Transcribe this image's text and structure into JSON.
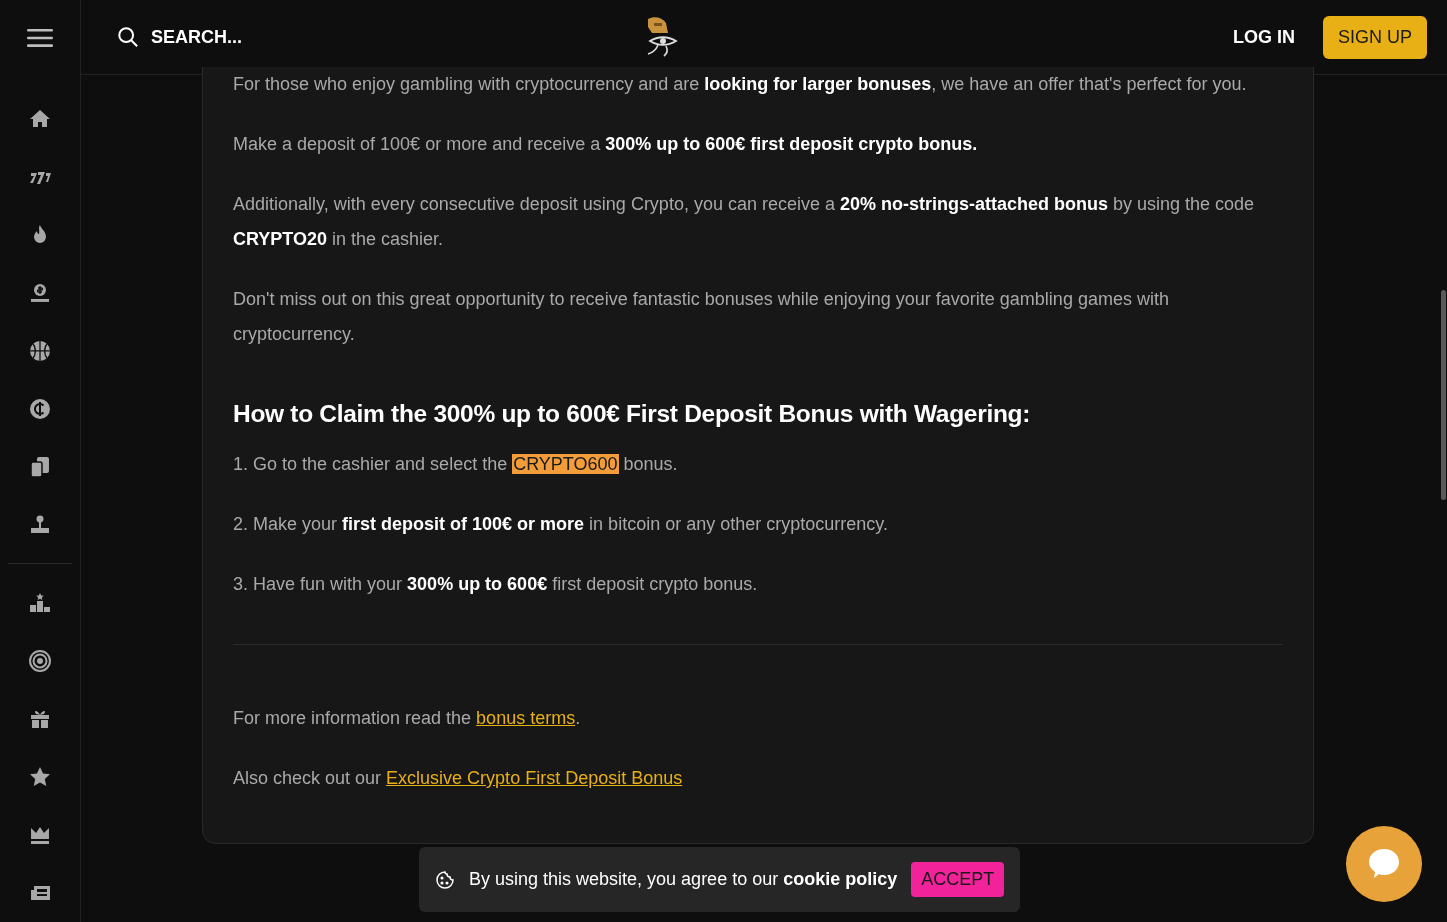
{
  "header": {
    "search_placeholder": "SEARCH...",
    "login": "LOG IN",
    "signup": "SIGN UP"
  },
  "article": {
    "paragraphs": [
      "For those who enjoy gambling with cryptocurrency and are **looking for larger bonuses**, we have an offer that's perfect for you.",
      "Make a deposit of 100€ or more and receive a **300% up to 600€ first deposit crypto bonus.**",
      "Additionally, with every consecutive deposit using Crypto, you can receive a **20% no-strings-attached bonus** by using the code **CRYPTO20** in the cashier.",
      "Don't miss out on this great opportunity to receive fantastic bonuses while enjoying your favorite gambling games with cryptocurrency."
    ],
    "heading": "How to Claim the 300% up to 600€ First Deposit Bonus with Wagering:",
    "steps": [
      {
        "kind": "highlight",
        "before": "1. Go to the cashier and select the ",
        "code": "CRYPTO600",
        "after": " bonus."
      },
      {
        "kind": "text",
        "text": "2. Make your **first deposit of 100€ or more** in bitcoin or any other cryptocurrency."
      },
      {
        "kind": "text",
        "text": "3. Have fun with your **300% up to 600€** first deposit crypto bonus."
      }
    ],
    "links": [
      {
        "before": "For more information read the ",
        "link": "bonus terms",
        "after": "."
      },
      {
        "before": "Also check out our ",
        "link": "Exclusive Crypto First Deposit Bonus"
      }
    ]
  },
  "cookie": {
    "text": "By using this website, you agree to our **cookie policy**",
    "button": "ACCEPT"
  }
}
